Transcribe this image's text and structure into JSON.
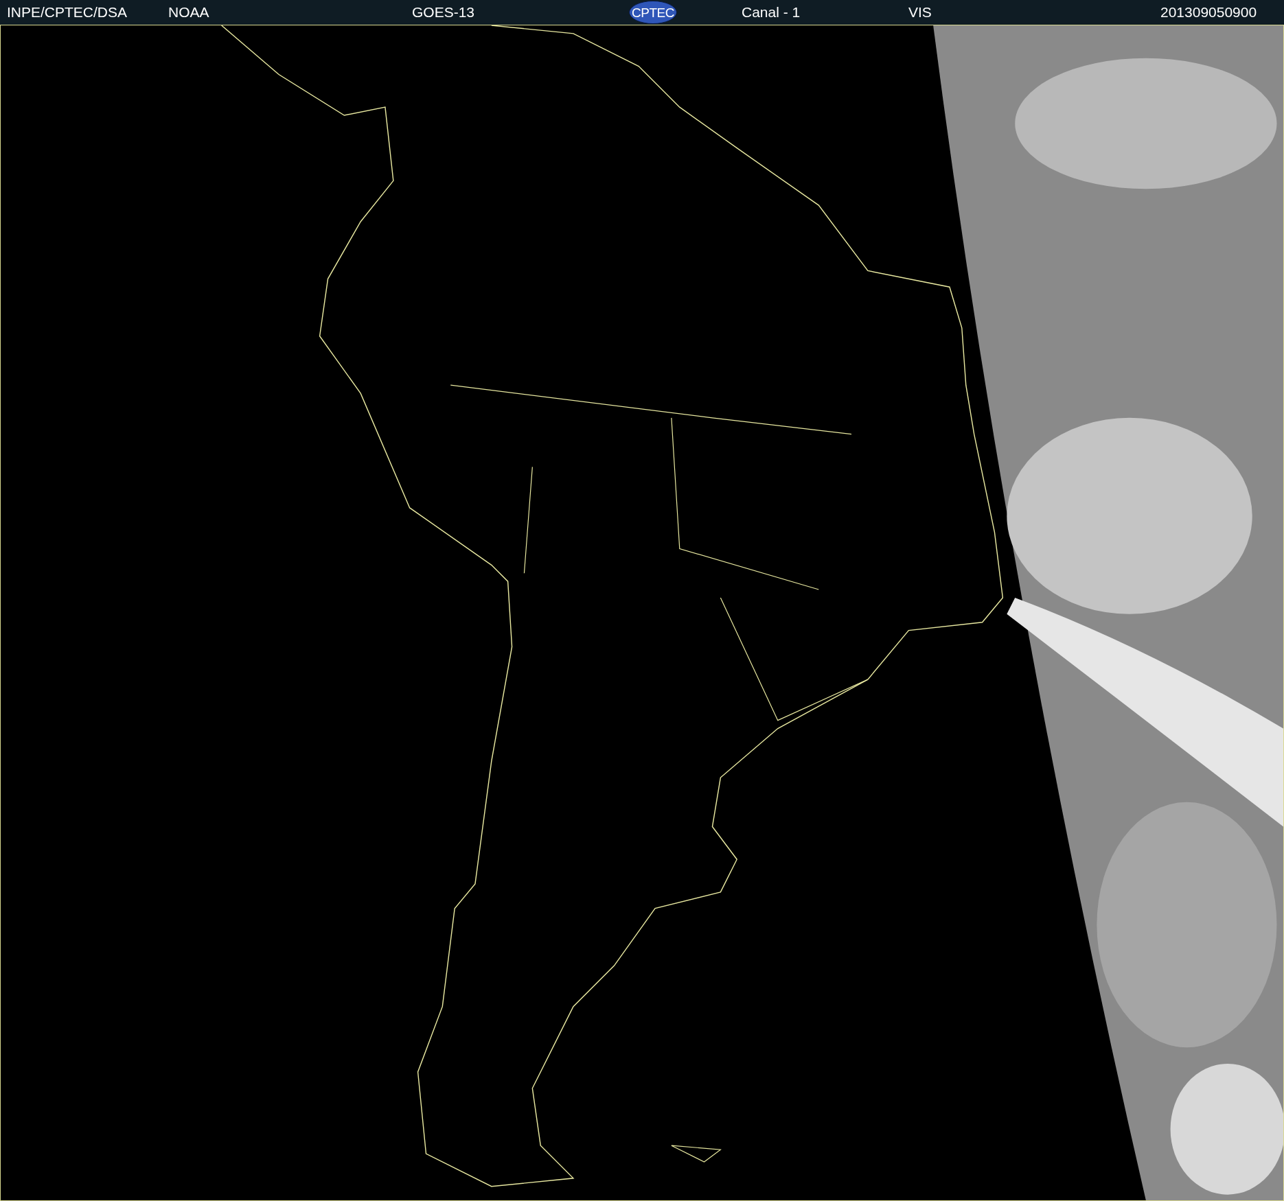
{
  "header": {
    "items": [
      {
        "kind": "text",
        "text": "INPE/CPTEC/DSA"
      },
      {
        "kind": "text",
        "text": "NOAA"
      },
      {
        "kind": "text",
        "text": "GOES-13"
      },
      {
        "kind": "logo",
        "text": "CPTEC"
      },
      {
        "kind": "text",
        "text": "Canal - 1"
      },
      {
        "kind": "text",
        "text": "VIS"
      },
      {
        "kind": "text",
        "text": "201309050900"
      }
    ]
  }
}
